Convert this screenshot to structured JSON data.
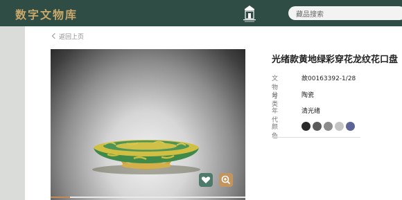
{
  "header": {
    "logo": "数字文物库",
    "search_placeholder": "藏品搜索"
  },
  "nav": {
    "back_label": "返回上页"
  },
  "artifact": {
    "title": "光绪款黄地绿彩穿花龙纹花口盘",
    "fields": [
      {
        "label": "文物号",
        "value": "故00163392-1/28"
      },
      {
        "label": "分类",
        "value": "陶瓷"
      },
      {
        "label": "年代",
        "value": "清光绪"
      }
    ],
    "color_label": "颜色",
    "colors": [
      "#2b2b2b",
      "#5b5b5b",
      "#8c8c8c",
      "#c4c4c4",
      "#5d6496"
    ]
  },
  "viewer": {
    "progress": 0.1,
    "favorite_icon": "heart-icon",
    "zoom_icon": "zoom-plus-icon"
  }
}
